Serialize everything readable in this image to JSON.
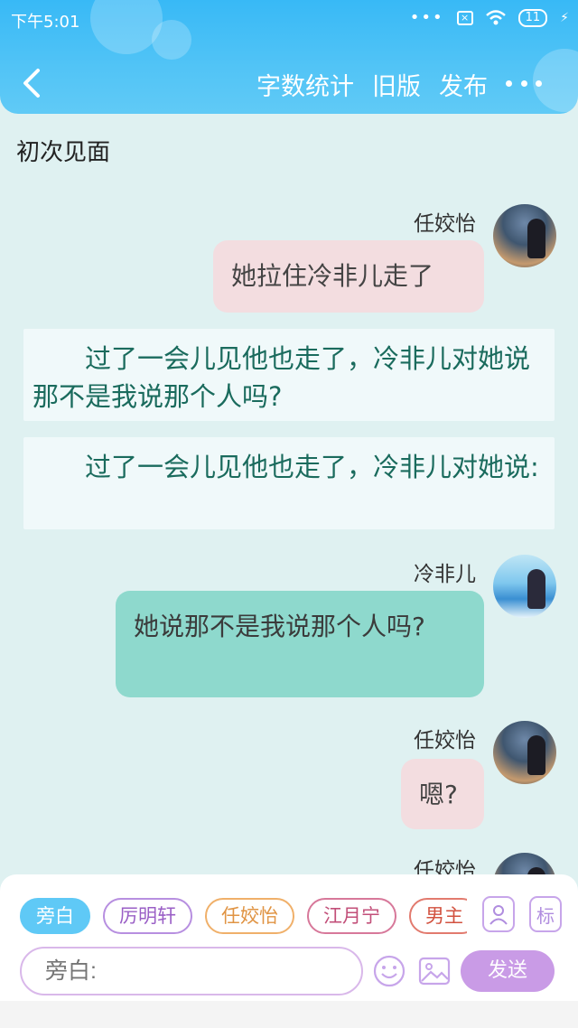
{
  "status": {
    "time": "下午5:01",
    "battery": "11"
  },
  "nav": {
    "actions": [
      "字数统计",
      "旧版",
      "发布"
    ]
  },
  "chat": {
    "title": "初次见面",
    "messages": [
      {
        "name": "任姣怡",
        "text": "她拉住冷非儿走了"
      },
      {
        "narration": "过了一会儿见他也走了，冷非儿对她说那不是我说那个人吗?"
      },
      {
        "narration": "过了一会儿见他也走了，冷非儿对她说:"
      },
      {
        "name": "冷非儿",
        "text": "她说那不是我说那个人吗?"
      },
      {
        "name": "任姣怡",
        "text": "嗯?"
      },
      {
        "name": "任姣怡"
      }
    ]
  },
  "panel": {
    "chips": [
      "旁白",
      "厉明轩",
      "任姣怡",
      "江月宁",
      "男主"
    ],
    "tag_button": "标",
    "input_placeholder": "旁白:",
    "send_label": "发送"
  },
  "colors": {
    "header": "#38b9f6",
    "background": "#dff1f1",
    "send": "#c99be6"
  }
}
